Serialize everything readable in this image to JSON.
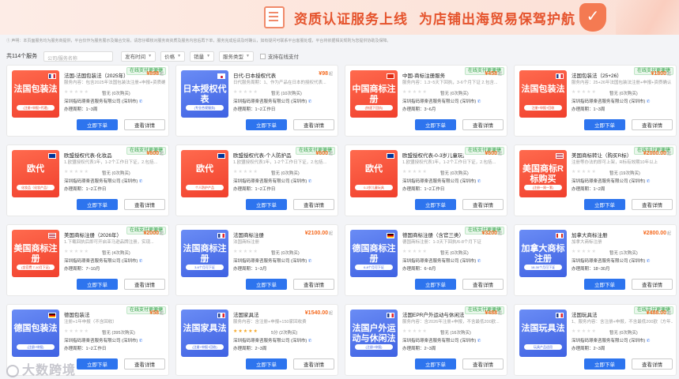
{
  "banner": {
    "title": "资质认证服务上线",
    "subtitle": "为店铺出海贸易保驾护航"
  },
  "notice": "① 声明：本页面服务均为服务商提供，平台仅作为服务展示及撮合交易，请您仔细核对服务商资质及服务内容后再下单，服务完成后请及时确认，如有疑问可联系平台客服处理，平台将依据相关规则为您提供协助及保障。",
  "filters": {
    "count": "共114个服务",
    "search_placeholder": "公司/服务名称",
    "sort_time": "发布时间",
    "price": "价格",
    "sales": "销量",
    "type": "服务类型",
    "online_pay": "支持在线支付"
  },
  "buttons": {
    "order": "立即下单",
    "detail": "查看详情"
  },
  "badge_text": "在线支付更便捷",
  "watermark": "大数跨境",
  "cards": [
    {
      "name": "法国-法国包装法（2025年）",
      "price": "¥898",
      "unit": "起",
      "desc": "服务内容：包含2025年法国包装法注册+申报+资质确认",
      "rating": "暂无 (0次购买)",
      "company": "深圳指码璟楽咨服务有限公司 (深圳市)",
      "period": "办理周期：1~3周",
      "thumb": "法国包装法",
      "thumb_sub": "(注册+申报+代理)",
      "thumb_color": "red",
      "flag": "fr",
      "badge": true,
      "gold": false
    },
    {
      "name": "日代-日本授权代表",
      "price": "¥98",
      "unit": "起",
      "desc": "日代服务周期：1、作为产品在日本的授权代表...",
      "rating": "暂无 (10次购买)",
      "company": "深圳指码璟楽咨服务有限公司 (深圳市)",
      "period": "办理周期：1~2工作日",
      "thumb": "日本授权代表",
      "thumb_sub": "(专业合规服务)",
      "thumb_color": "blue",
      "flag": "jp",
      "badge": false,
      "gold": false
    },
    {
      "name": "中国-商标注册服务",
      "price": "¥458",
      "unit": "起",
      "desc": "服务内容：1.3~5天下回执，3-6个月下证 2.包含...",
      "rating": "暂无 (0次购买)",
      "company": "深圳指码璟楽咨服务有限公司 (深圳市)",
      "period": "办理周期：3~6月",
      "thumb": "中国商标注册",
      "thumb_sub": "(快速下回执)",
      "thumb_color": "red",
      "flag": "cn",
      "badge": true,
      "gold": false
    },
    {
      "name": "法国包装法（25+26）",
      "price": "¥1800",
      "unit": "起",
      "desc": "服务内容：25+26年法国包装法注册+申报+资质确认",
      "rating": "暂无 (0次购买)",
      "company": "深圳指码璟楽咨服务有限公司 (深圳市)",
      "period": "办理周期：1~3周",
      "thumb": "法国包装法",
      "thumb_sub": "注册+申报+回收",
      "thumb_color": "red",
      "flag": "fr",
      "badge": true,
      "gold": false
    },
    {
      "name": "欧盟授权代表-化妆品",
      "price": "¥600",
      "unit": "起",
      "desc": "1.欧盟授权代表1年，1-2个工作日下证，2.包括...",
      "rating": "暂无 (0次购买)",
      "company": "深圳指码璟楽咨服务有限公司 (深圳市)",
      "period": "办理周期：1~2工作日",
      "thumb": "欧代",
      "thumb_sub": "化妆品（化妆产品）",
      "thumb_color": "red",
      "flag": "eu",
      "badge": true,
      "gold": false
    },
    {
      "name": "欧盟授权代表-个人防护品",
      "price": "¥600",
      "unit": "起",
      "desc": "1.欧盟授权代表1年，1-2个工作日下证，2.包括...",
      "rating": "暂无 (0次购买)",
      "company": "深圳指码璟楽咨服务有限公司 (深圳市)",
      "period": "办理周期：1~2工作日",
      "thumb": "欧代",
      "thumb_sub": "个人防护产品",
      "thumb_color": "red",
      "flag": "eu",
      "badge": true,
      "gold": false
    },
    {
      "name": "欧盟授权代表-0-3岁儿童玩具",
      "price": "¥600",
      "unit": "起",
      "desc": "1.欧盟授权代表1年，1-2个工作日下证，2.包括...",
      "rating": "暂无 (0次购买)",
      "company": "深圳指码璟楽咨服务有限公司 (深圳市)",
      "period": "办理周期：1~2工作日",
      "thumb": "欧代",
      "thumb_sub": "0-3岁儿童玩具",
      "thumb_color": "red",
      "flag": "eu",
      "badge": true,
      "gold": false
    },
    {
      "name": "美国商标转让（购买R标）",
      "price": "¥2000.00",
      "unit": "起",
      "desc": "注册等办法的即可上架，R标有效期10年以上",
      "rating": "暂无 (19次购买)",
      "company": "深圳指码璟楽咨服务有限公司 (深圳市)",
      "period": "办理周期：1~2周",
      "thumb": "美国商标R标购买",
      "thumb_sub": "(注册一周一套)",
      "thumb_color": "red",
      "flag": "us",
      "badge": true,
      "gold": false
    },
    {
      "name": "美国商标注册（2026年）",
      "price": "¥2000",
      "unit": "起",
      "desc": "1.下载回执后即可开启亚马逊品牌注册，实现...",
      "rating": "暂无 (4次购买)",
      "company": "深圳指码璟楽咨服务有限公司 (深圳市)",
      "period": "办理周期：7~10月",
      "thumb": "美国商标注册",
      "thumb_sub": "(含官费 7-10月下证)",
      "thumb_color": "red",
      "flag": "us",
      "badge": true,
      "gold": false
    },
    {
      "name": "法国商标注册",
      "price": "¥2100.00",
      "unit": "起",
      "desc": "法国商标注册",
      "rating": "暂无 (0次购买)",
      "company": "深圳指码璟楽咨服务有限公司 (深圳市)",
      "period": "办理周期：1~3月",
      "thumb": "法国商标注册",
      "thumb_sub": "3-6个月可下证",
      "thumb_color": "blue",
      "flag": "fr",
      "badge": false,
      "gold": false
    },
    {
      "name": "德国商标注册（含官三类）",
      "price": "¥3200",
      "unit": "起",
      "desc": "德国商标注册：1-3天下回执/6-8个月下证",
      "rating": "暂无 (0次购买)",
      "company": "深圳指码璟楽咨服务有限公司 (深圳市)",
      "period": "办理周期：6~8月",
      "thumb": "德国商标注册",
      "thumb_sub": "6-8个月可下证",
      "thumb_color": "blue",
      "flag": "de",
      "badge": true,
      "gold": false
    },
    {
      "name": "加拿大商标注册",
      "price": "¥2800.00",
      "unit": "起",
      "desc": "加拿大商标注册",
      "rating": "暂无 (1次购买)",
      "company": "深圳指码璟楽咨服务有限公司 (深圳市)",
      "period": "办理周期：18~30月",
      "thumb": "加拿大商标注册",
      "thumb_sub": "18-30个月可下证",
      "thumb_color": "blue",
      "flag": "ca",
      "badge": false,
      "gold": false
    },
    {
      "name": "德国包装法",
      "price": "¥58",
      "unit": "起",
      "desc": "注册+1年申报（不含回收）",
      "rating": "暂无 (395次购买)",
      "company": "深圳指码璟楽咨服务有限公司 (深圳市)",
      "period": "办理周期：1~2工作日",
      "thumb": "德国包装法",
      "thumb_sub": "(注册+申报)",
      "thumb_color": "blue",
      "flag": "de",
      "badge": true,
      "gold": false
    },
    {
      "name": "法国家具法",
      "price": "¥1540.00",
      "unit": "起",
      "desc": "服务内容：含注册+申报+150家回收费",
      "rating": "5分 (2次购买)",
      "company": "深圳指码璟楽咨服务有限公司 (深圳市)",
      "period": "办理周期：2~3周",
      "thumb": "法国家具法",
      "thumb_sub": "(注册+申报+回收)",
      "thumb_color": "blue",
      "flag": "fr",
      "badge": false,
      "gold": true
    },
    {
      "name": "法国EPR户外运动与休闲法",
      "price": "¥488",
      "unit": "起",
      "desc": "服务内容：含2026年注册+申报，不含最低200欧...",
      "rating": "暂无 (16次购买)",
      "company": "深圳指码璟楽咨服务有限公司 (深圳市)",
      "period": "办理周期：2~3周",
      "thumb": "法国户外运动与休闲法",
      "thumb_sub": "(注册+申报)",
      "thumb_color": "blue",
      "flag": "fr",
      "badge": true,
      "gold": false
    },
    {
      "name": "法国玩具法",
      "price": "¥488.00",
      "unit": "起",
      "desc": "1、服务内容：含注册+申报，不含最低200欧（方年...",
      "rating": "暂无 (0次购买)",
      "company": "深圳指码璟楽咨服务有限公司 (深圳市)",
      "period": "办理周期：2~3周",
      "thumb": "法国玩具法",
      "thumb_sub": "玩具产品适用",
      "thumb_color": "blue",
      "flag": "fr",
      "badge": true,
      "gold": false
    }
  ]
}
